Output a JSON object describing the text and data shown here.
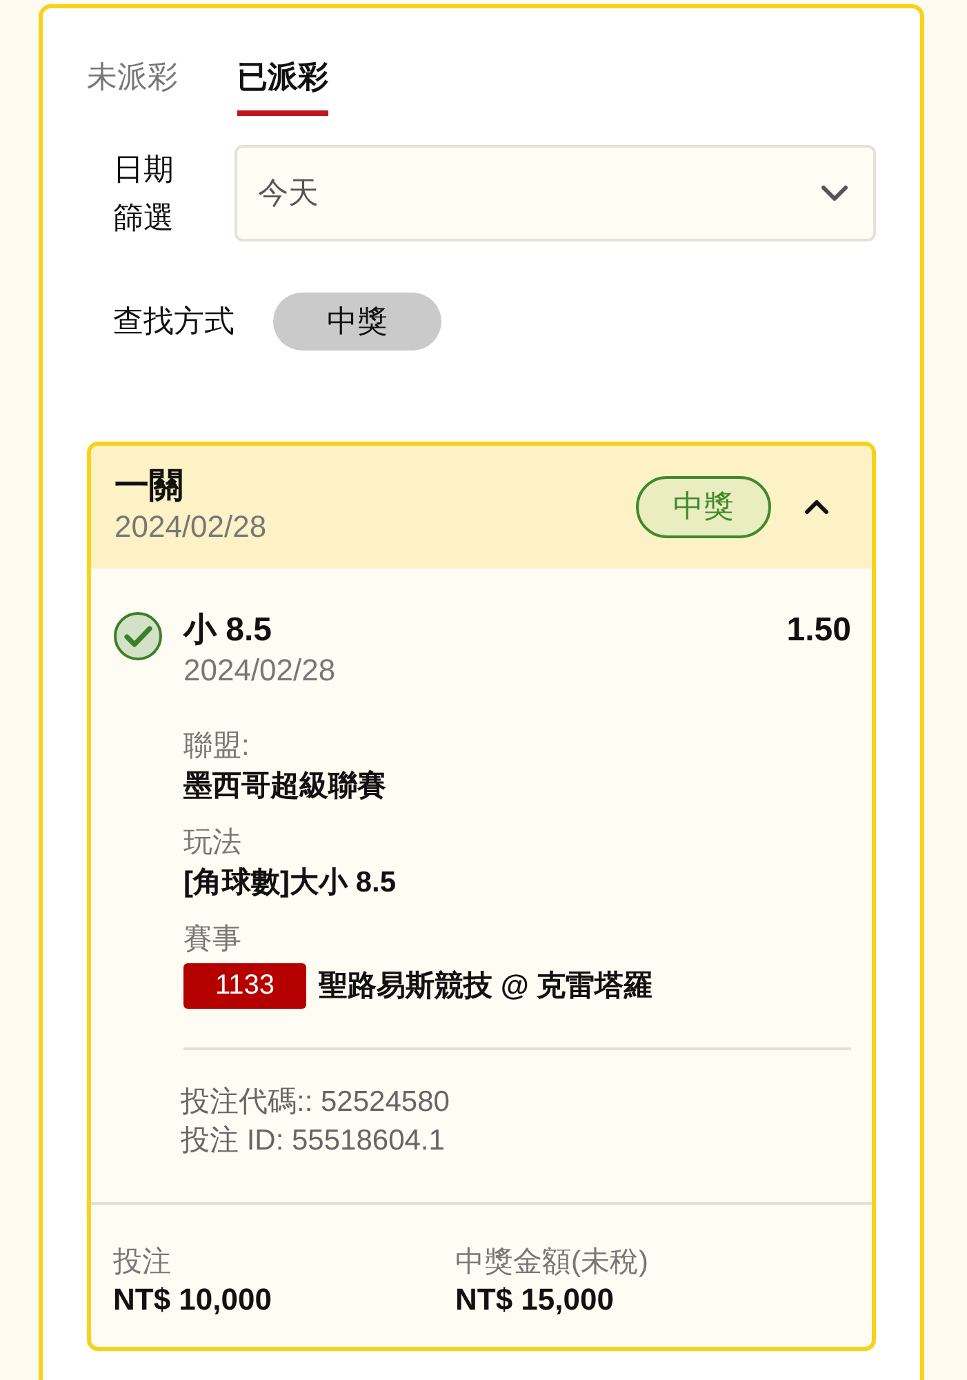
{
  "tabs": [
    {
      "label": "未派彩",
      "selected": false
    },
    {
      "label": "已派彩",
      "selected": true
    }
  ],
  "date_filter": {
    "label": "日期篩選",
    "value": "今天"
  },
  "search_method": {
    "label": "查找方式",
    "chip": "中獎"
  },
  "bets": [
    {
      "title": "一關",
      "date": "2024/02/28",
      "status": "中獎",
      "expanded": true,
      "selections": [
        {
          "won": true,
          "pick": "小 8.5",
          "odds": "1.50",
          "date": "2024/02/28",
          "details": [
            {
              "label": "聯盟:",
              "value": "墨西哥超級聯賽"
            },
            {
              "label": "玩法",
              "value": "[角球數]大小 8.5"
            },
            {
              "label": "賽事",
              "match_no": "1133",
              "value": "聖路易斯競技 @ 克雷塔羅"
            }
          ]
        }
      ],
      "bet_code": "投注代碼:: 52524580",
      "bet_id": "投注 ID: 55518604.1",
      "summary": [
        {
          "label": "投注",
          "value": "NT$ 10,000"
        },
        {
          "label": "中獎金額(未稅)",
          "value": "NT$ 15,000"
        }
      ]
    }
  ]
}
